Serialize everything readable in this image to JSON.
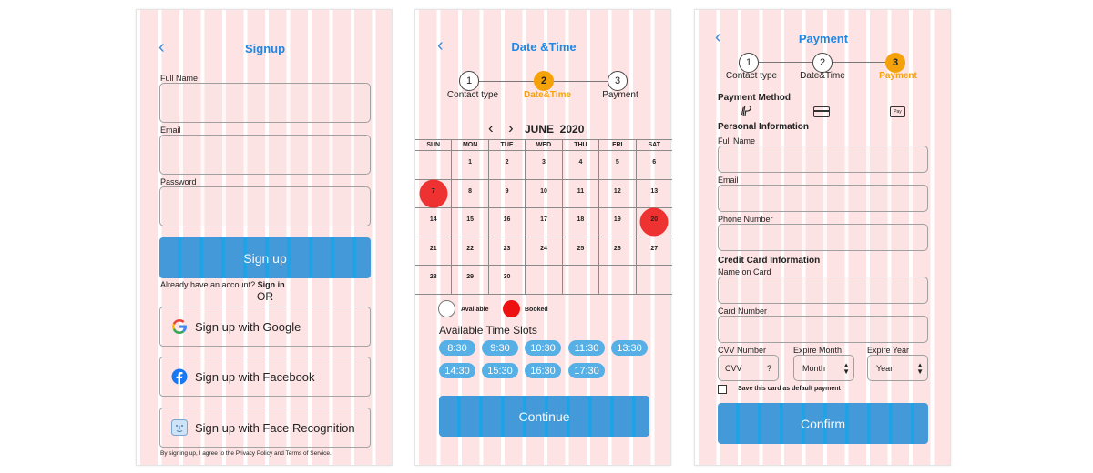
{
  "signup": {
    "back_glyph": "‹",
    "title": "Signup",
    "full_name_label": "Full Name",
    "email_label": "Email",
    "password_label": "Password",
    "signup_button": "Sign up",
    "have_account": "Already have an account?",
    "sign_in": "Sign in",
    "or": "OR",
    "google_button": "Sign up with Google",
    "facebook_button": "Sign up with Facebook",
    "face_button": "Sign up with Face Recognition",
    "terms": "By signing up, I agree to the Privacy Policy and Terms of Service."
  },
  "datetime": {
    "back_glyph": "‹",
    "title": "Date &Time",
    "steps": [
      {
        "num": "1",
        "label": "Contact type"
      },
      {
        "num": "2",
        "label": "Date&Time"
      },
      {
        "num": "3",
        "label": "Payment"
      }
    ],
    "active_step": 2,
    "prev_glyph": "‹",
    "next_glyph": "›",
    "month_label": "JUNE  2020",
    "weekdays": [
      "SUN",
      "MON",
      "TUE",
      "WED",
      "THU",
      "FRI",
      "SAT"
    ],
    "weeks": [
      [
        "",
        "1",
        "2",
        "3",
        "4",
        "5",
        "6"
      ],
      [
        "7",
        "8",
        "9",
        "10",
        "11",
        "12",
        "13"
      ],
      [
        "14",
        "15",
        "16",
        "17",
        "18",
        "19",
        "20"
      ],
      [
        "21",
        "22",
        "23",
        "24",
        "25",
        "26",
        "27"
      ],
      [
        "28",
        "29",
        "30",
        "",
        "",
        "",
        ""
      ]
    ],
    "booked_days": [
      "7",
      "20"
    ],
    "legend_available": "Available",
    "legend_booked": "Booked",
    "slots_title": "Available Time Slots",
    "slots": [
      "8:30",
      "9:30",
      "10:30",
      "11:30",
      "13:30",
      "14:30",
      "15:30",
      "16:30",
      "17:30"
    ],
    "continue_button": "Continue"
  },
  "payment": {
    "back_glyph": "‹",
    "title": "Payment",
    "steps": [
      {
        "num": "1",
        "label": "Contact type"
      },
      {
        "num": "2",
        "label": "Date&Time"
      },
      {
        "num": "3",
        "label": "Payment"
      }
    ],
    "active_step": 3,
    "method_title": "Payment Method",
    "paypal_glyph": "P",
    "applepay_glyph": "Pay",
    "personal_title": "Personal Information",
    "full_name_label": "Full Name",
    "email_label": "Email",
    "phone_label": "Phone Number",
    "card_title": "Credit Card Information",
    "name_on_card_label": "Name on Card",
    "card_number_label": "Card Number",
    "cvv_label": "CVV Number",
    "cvv_placeholder": "CVV",
    "cvv_help": "?",
    "expire_month_label": "Expire Month",
    "expire_month_value": "Month",
    "expire_year_label": "Expire Year",
    "expire_year_value": "Year",
    "save_card_label": "Save this card as default payment",
    "confirm_button": "Confirm"
  },
  "colors": {
    "accent_blue": "#1e88e5",
    "button_blue": "#4499d8",
    "step_orange": "#f5a20a",
    "booked_red": "#ee3131"
  }
}
